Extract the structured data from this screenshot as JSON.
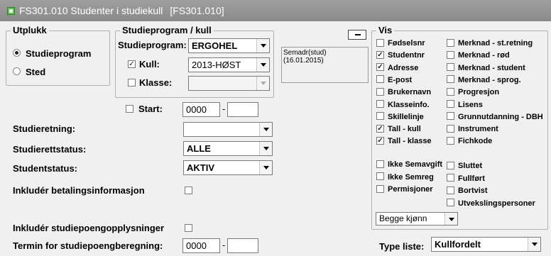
{
  "window": {
    "title": "FS301.010 Studenter i studiekull",
    "code": "[FS301.010]"
  },
  "utplukk": {
    "legend": "Utplukk",
    "options": [
      "Studieprogram",
      "Sted"
    ],
    "selected": 0
  },
  "studieprogram": {
    "legend": "Studieprogram / kull",
    "program_label": "Studieprogram:",
    "program_value": "ERGOHEL",
    "kull_label": "Kull:",
    "kull_checked": true,
    "kull_value": "2013-HØST",
    "klasse_label": "Klasse:",
    "klasse_checked": false,
    "klasse_value": ""
  },
  "start": {
    "label": "Start:",
    "checked": false,
    "year": "0000",
    "term": ""
  },
  "info": {
    "line1": "Semadr(stud)",
    "line2": "(16.01.2015)"
  },
  "fields": {
    "studieretning_label": "Studieretning:",
    "studieretning_value": "",
    "studierettstatus_label": "Studierettstatus:",
    "studierettstatus_value": "ALLE",
    "studentstatus_label": "Studentstatus:",
    "studentstatus_value": "AKTIV",
    "betaling_label": "Inkludér betalingsinformasjon",
    "betaling_checked": false,
    "studiepoeng_label": "Inkludér studiepoengopplysninger",
    "studiepoeng_checked": false,
    "termin_label": "Termin for studiepoengberegning:",
    "termin_year": "0000",
    "termin_term": ""
  },
  "vis": {
    "legend": "Vis",
    "col1": [
      {
        "label": "Fødselsnr",
        "checked": false
      },
      {
        "label": "Studentnr",
        "checked": true
      },
      {
        "label": "Adresse",
        "checked": true
      },
      {
        "label": "E-post",
        "checked": false
      },
      {
        "label": "Brukernavn",
        "checked": false
      },
      {
        "label": "Klasseinfo.",
        "checked": false
      },
      {
        "label": "Skillelinje",
        "checked": false
      },
      {
        "label": "Tall - kull",
        "checked": true
      },
      {
        "label": "Tall - klasse",
        "checked": true
      }
    ],
    "col2": [
      {
        "label": "Merknad - st.retning",
        "checked": false
      },
      {
        "label": "Merknad - rød",
        "checked": false
      },
      {
        "label": "Merknad - student",
        "checked": false
      },
      {
        "label": "Merknad - sprog.",
        "checked": false
      },
      {
        "label": "Progresjon",
        "checked": false
      },
      {
        "label": "Lisens",
        "checked": false
      },
      {
        "label": "Grunnutdanning - DBH",
        "checked": false
      },
      {
        "label": "Instrument",
        "checked": false
      },
      {
        "label": "Fichkode",
        "checked": false
      }
    ],
    "col3": [
      {
        "label": "Ikke Semavgift",
        "checked": false
      },
      {
        "label": "Ikke Semreg",
        "checked": false
      },
      {
        "label": "Permisjoner",
        "checked": false
      }
    ],
    "col4": [
      {
        "label": "Sluttet",
        "checked": false
      },
      {
        "label": "Fullført",
        "checked": false
      },
      {
        "label": "Bortvist",
        "checked": false
      },
      {
        "label": "Utvekslingspersoner",
        "checked": false
      }
    ],
    "gender_value": "Begge kjønn"
  },
  "type_liste": {
    "label": "Type liste:",
    "value": "Kullfordelt"
  }
}
